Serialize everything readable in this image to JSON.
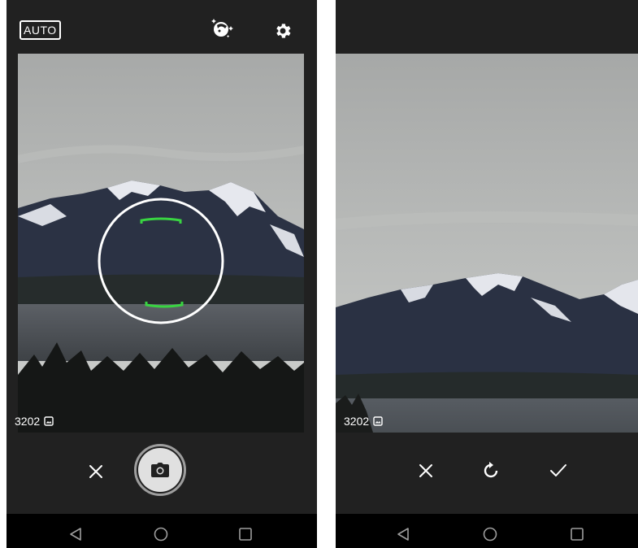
{
  "camera_screen": {
    "flash_mode_label": "AUTO",
    "photo_counter": "3202",
    "icons": {
      "face_beauty": "face-beauty-icon",
      "settings": "gear-icon",
      "gallery": "gallery-icon",
      "close": "close-icon",
      "shutter": "camera-icon"
    }
  },
  "review_screen": {
    "photo_counter": "3202",
    "icons": {
      "gallery": "gallery-icon",
      "discard": "close-icon",
      "retake": "retake-icon",
      "confirm": "check-icon"
    }
  },
  "navigation": {
    "back": "back-icon",
    "home": "home-icon",
    "recents": "recents-icon"
  },
  "colors": {
    "bar_background": "#212121",
    "nav_background": "#000000",
    "focus_bracket": "#39d442",
    "focus_ring": "#ffffff"
  }
}
